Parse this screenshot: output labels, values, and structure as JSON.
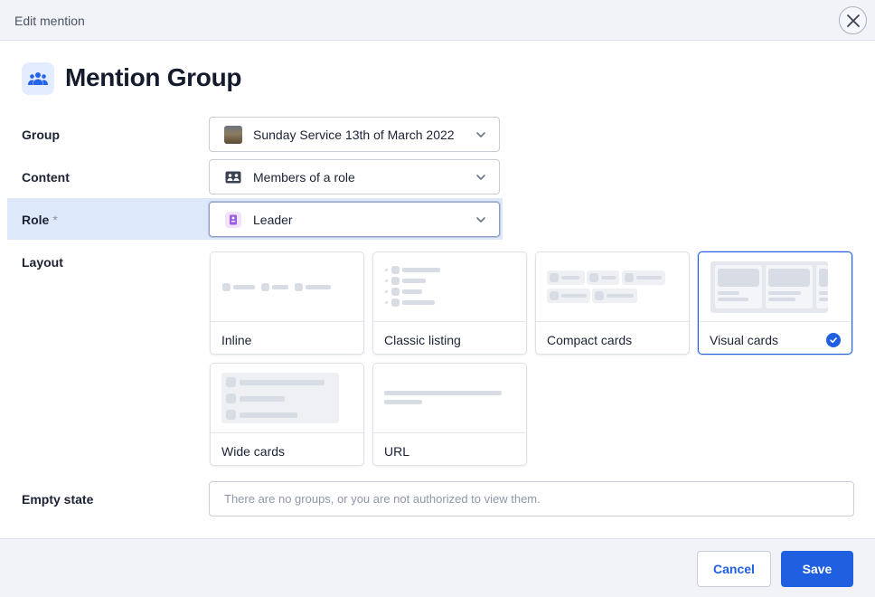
{
  "header": {
    "title": "Edit mention",
    "close_icon": "close-icon"
  },
  "page": {
    "title": "Mention Group",
    "icon": "people-group-icon",
    "accent": "#1f5fe0"
  },
  "form": {
    "group": {
      "label": "Group",
      "value": "Sunday Service 13th of March 2022",
      "icon": "group-thumbnail"
    },
    "content": {
      "label": "Content",
      "value": "Members of a role",
      "icon": "roster-icon"
    },
    "role": {
      "label": "Role",
      "required_mark": "*",
      "value": "Leader",
      "icon": "role-badge-icon",
      "icon_color": "#9b5ce0"
    },
    "layout": {
      "label": "Layout",
      "options": [
        {
          "label": "Inline",
          "selected": false
        },
        {
          "label": "Classic listing",
          "selected": false
        },
        {
          "label": "Compact cards",
          "selected": false
        },
        {
          "label": "Visual cards",
          "selected": true
        },
        {
          "label": "Wide cards",
          "selected": false
        },
        {
          "label": "URL",
          "selected": false
        }
      ]
    },
    "empty_state": {
      "label": "Empty state",
      "placeholder": "There are no groups, or you are not authorized to view them.",
      "value": ""
    }
  },
  "footer": {
    "cancel_label": "Cancel",
    "save_label": "Save"
  }
}
